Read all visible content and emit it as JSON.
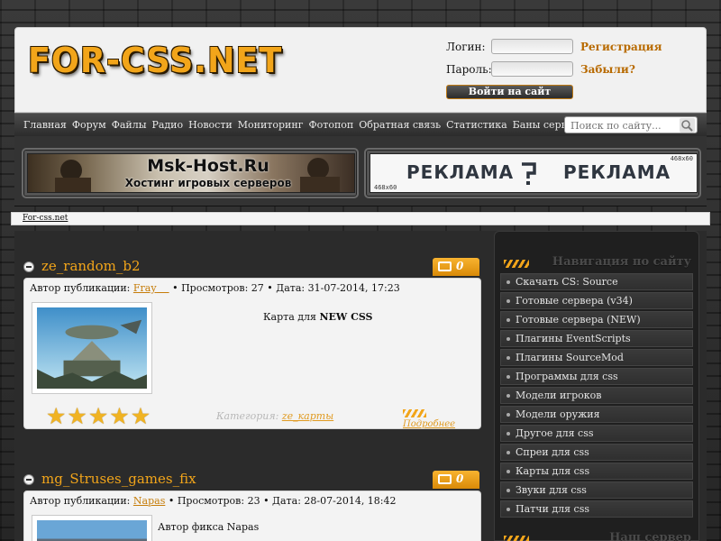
{
  "site": {
    "logo": "FOR-CSS.NET"
  },
  "login": {
    "login_label": "Логин:",
    "password_label": "Пароль:",
    "register_link": "Регистрация",
    "forgot_link": "Забыли?",
    "submit_label": "Войти на сайт"
  },
  "nav": {
    "items": [
      "Главная",
      "Форум",
      "Файлы",
      "Радио",
      "Новости",
      "Мониторинг",
      "Фотопоп",
      "Обратная связь",
      "Статистика",
      "Баны сервера"
    ],
    "search_placeholder": "Поиск по сайту..."
  },
  "banners": {
    "host_title": "Msk-Host.Ru",
    "host_subtitle": "Хостинг игровых серверов",
    "ad_word": "РЕКЛАМА",
    "ad_size": "468x60"
  },
  "breadcrumb": "For-css.net",
  "posts": [
    {
      "title": "ze_random_b2",
      "comments": "0",
      "author_label": "Автор публикации:",
      "author": "Fray",
      "views": "• Просмотров: 27 • Дата: 31-07-2014, 17:23",
      "text_prefix": "Карта для ",
      "text_bold": "NEW CSS",
      "rating": 5,
      "category_label": "Категория:",
      "category": "ze_карты",
      "more": "Подробнее"
    },
    {
      "title": "mg_Struses_games_fix",
      "comments": "0",
      "author_label": "Автор публикации:",
      "author": "Napas",
      "views": "• Просмотров: 23 • Дата: 28-07-2014, 18:42",
      "text": "Автор фикса Napas"
    }
  ],
  "sidebar": {
    "nav_title": "Навигация по сайту",
    "items": [
      "Скачать CS: Source",
      "Готовые сервера (v34)",
      "Готовые сервера (NEW)",
      "Плагины EventScripts",
      "Плагины SourceMod",
      "Программы для css",
      "Модели игроков",
      "Модели оружия",
      "Другое для css",
      "Спреи для css",
      "Карты для css",
      "Звуки для css",
      "Патчи для css"
    ],
    "server_title": "Наш сервер"
  },
  "colors": {
    "accent": "#f2a51a",
    "link": "#c67d0a",
    "dark": "#2b2b2b"
  }
}
